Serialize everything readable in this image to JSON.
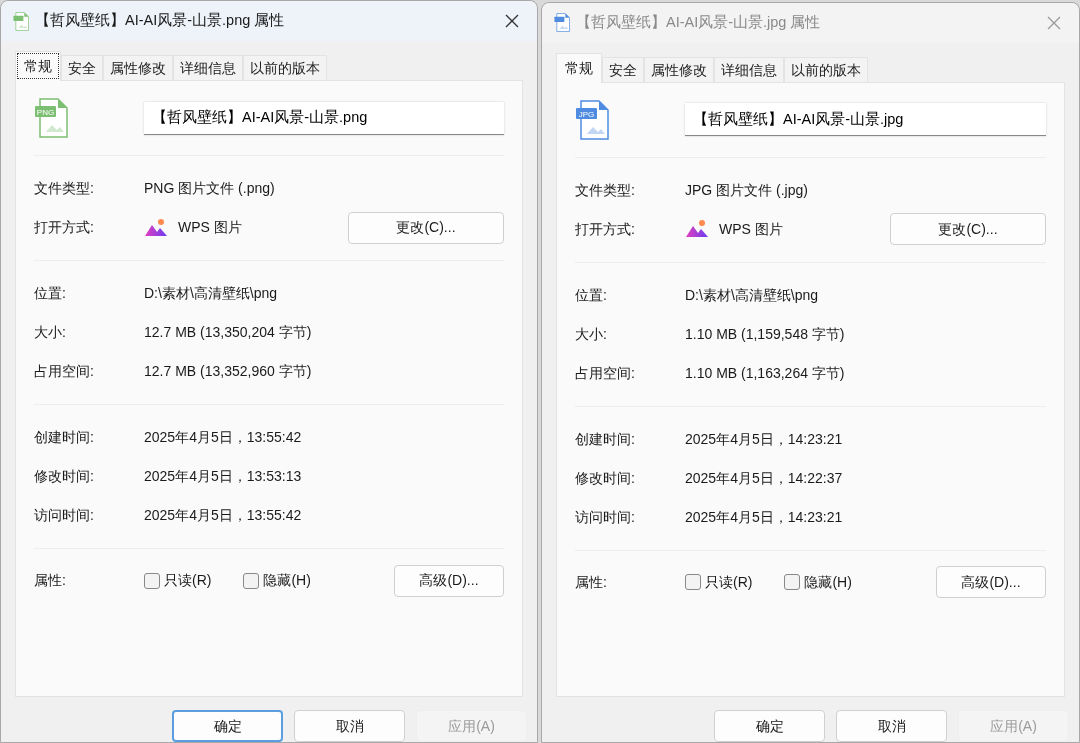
{
  "windows": [
    {
      "title": "【哲风壁纸】AI-AI风景-山景.png 属性",
      "active": true,
      "file_type": {
        "label": "PNG",
        "color": "#7cbf72"
      },
      "tabs": [
        {
          "label": "常规",
          "selected": true,
          "focused": true
        },
        {
          "label": "安全",
          "selected": false,
          "focused": false
        },
        {
          "label": "属性修改",
          "selected": false,
          "focused": false
        },
        {
          "label": "详细信息",
          "selected": false,
          "focused": false
        },
        {
          "label": "以前的版本",
          "selected": false,
          "focused": false
        }
      ],
      "file_name": "【哲风壁纸】AI-AI风景-山景.png",
      "sections": [
        [
          {
            "kind": "text",
            "label": "文件类型:",
            "value": "PNG 图片文件 (.png)"
          },
          {
            "kind": "app",
            "label": "打开方式:",
            "value": "WPS 图片",
            "button": "更改(C)..."
          }
        ],
        [
          {
            "kind": "text",
            "label": "位置:",
            "value": "D:\\素材\\高清壁纸\\png"
          },
          {
            "kind": "text",
            "label": "大小:",
            "value": "12.7 MB (13,350,204 字节)"
          },
          {
            "kind": "text",
            "label": "占用空间:",
            "value": "12.7 MB (13,352,960 字节)"
          }
        ],
        [
          {
            "kind": "text",
            "label": "创建时间:",
            "value": "2025年4月5日，13:55:42"
          },
          {
            "kind": "text",
            "label": "修改时间:",
            "value": "2025年4月5日，13:53:13"
          },
          {
            "kind": "text",
            "label": "访问时间:",
            "value": "2025年4月5日，13:55:42"
          }
        ]
      ],
      "attributes": {
        "label": "属性:",
        "checkboxes": [
          {
            "label": "只读(R)",
            "checked": false
          },
          {
            "label": "隐藏(H)",
            "checked": false
          }
        ],
        "button": "高级(D)..."
      },
      "buttons": [
        {
          "label": "确定",
          "default": true,
          "disabled": false
        },
        {
          "label": "取消",
          "default": false,
          "disabled": false
        },
        {
          "label": "应用(A)",
          "default": false,
          "disabled": true
        }
      ]
    },
    {
      "title": "【哲风壁纸】AI-AI风景-山景.jpg 属性",
      "active": false,
      "file_type": {
        "label": "JPG",
        "color": "#4f8be0"
      },
      "tabs": [
        {
          "label": "常规",
          "selected": true,
          "focused": false
        },
        {
          "label": "安全",
          "selected": false,
          "focused": false
        },
        {
          "label": "属性修改",
          "selected": false,
          "focused": false
        },
        {
          "label": "详细信息",
          "selected": false,
          "focused": false
        },
        {
          "label": "以前的版本",
          "selected": false,
          "focused": false
        }
      ],
      "file_name": "【哲风壁纸】AI-AI风景-山景.jpg",
      "sections": [
        [
          {
            "kind": "text",
            "label": "文件类型:",
            "value": "JPG 图片文件 (.jpg)"
          },
          {
            "kind": "app",
            "label": "打开方式:",
            "value": "WPS 图片",
            "button": "更改(C)..."
          }
        ],
        [
          {
            "kind": "text",
            "label": "位置:",
            "value": "D:\\素材\\高清壁纸\\png"
          },
          {
            "kind": "text",
            "label": "大小:",
            "value": "1.10 MB (1,159,548 字节)"
          },
          {
            "kind": "text",
            "label": "占用空间:",
            "value": "1.10 MB (1,163,264 字节)"
          }
        ],
        [
          {
            "kind": "text",
            "label": "创建时间:",
            "value": "2025年4月5日，14:23:21"
          },
          {
            "kind": "text",
            "label": "修改时间:",
            "value": "2025年4月5日，14:22:37"
          },
          {
            "kind": "text",
            "label": "访问时间:",
            "value": "2025年4月5日，14:23:21"
          }
        ]
      ],
      "attributes": {
        "label": "属性:",
        "checkboxes": [
          {
            "label": "只读(R)",
            "checked": false
          },
          {
            "label": "隐藏(H)",
            "checked": false
          }
        ],
        "button": "高级(D)..."
      },
      "buttons": [
        {
          "label": "确定",
          "default": false,
          "disabled": false
        },
        {
          "label": "取消",
          "default": false,
          "disabled": false
        },
        {
          "label": "应用(A)",
          "default": false,
          "disabled": true
        }
      ]
    }
  ]
}
